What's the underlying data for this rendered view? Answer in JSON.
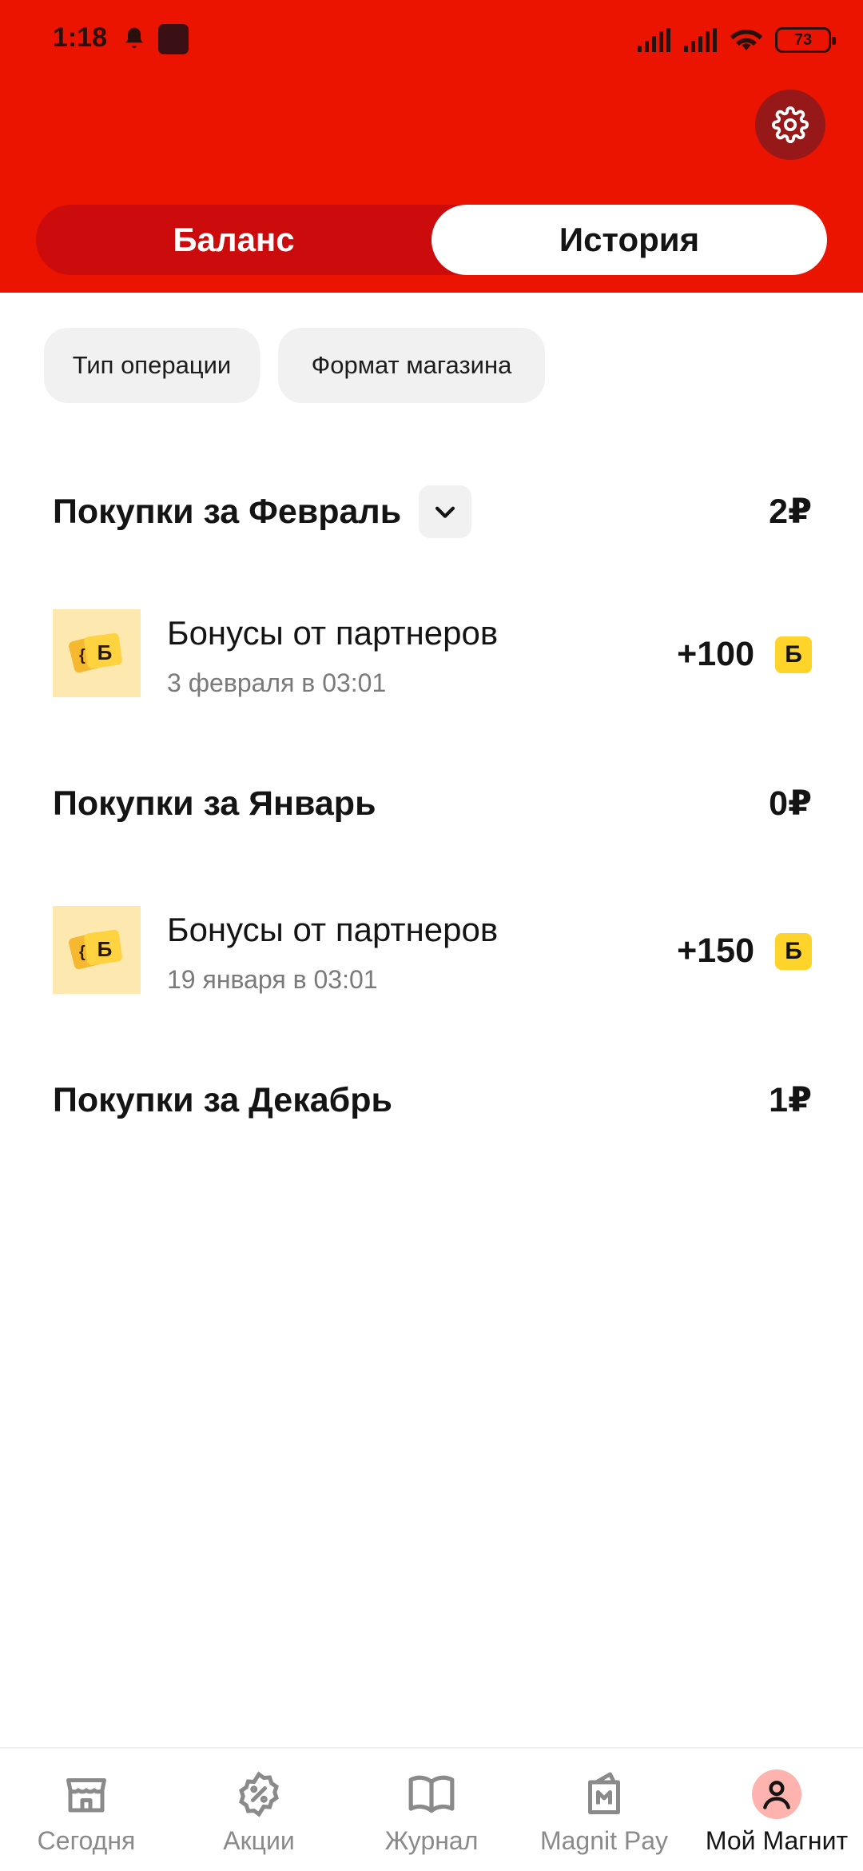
{
  "status_bar": {
    "time": "1:18",
    "battery": "73"
  },
  "tabs": {
    "balance": "Баланс",
    "history": "История"
  },
  "filters": [
    "Тип операции",
    "Формат магазина"
  ],
  "sections": [
    {
      "title": "Покупки за Февраль",
      "amount": "2₽",
      "transactions": [
        {
          "title": "Бонусы от партнеров",
          "date": "3 февраля в 03:01",
          "amount": "+100",
          "badge": "Б"
        }
      ]
    },
    {
      "title": "Покупки за Январь",
      "amount": "0₽",
      "transactions": [
        {
          "title": "Бонусы от партнеров",
          "date": "19 января в 03:01",
          "amount": "+150",
          "badge": "Б"
        }
      ]
    },
    {
      "title": "Покупки за Декабрь",
      "amount": "1₽",
      "transactions": []
    }
  ],
  "icon_badge_letter": "Б",
  "bottom_nav": [
    {
      "label": "Сегодня",
      "icon": "store-icon"
    },
    {
      "label": "Акции",
      "icon": "discount-icon"
    },
    {
      "label": "Журнал",
      "icon": "book-icon"
    },
    {
      "label": "Magnit Pay",
      "icon": "wallet-icon"
    },
    {
      "label": "Мой Магнит",
      "icon": "profile-icon"
    }
  ],
  "colors": {
    "brand_red": "#ea1400",
    "bonus_yellow": "#ffd42a"
  }
}
